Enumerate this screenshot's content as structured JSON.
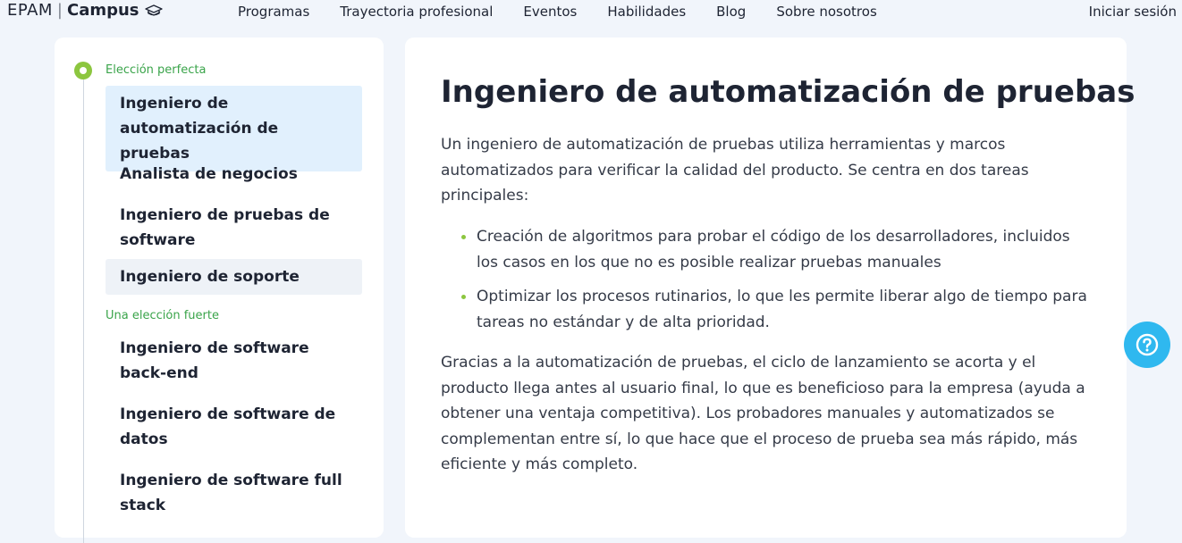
{
  "header": {
    "logo": {
      "brand": "EPAM",
      "separator": "|",
      "product": "Campus",
      "icon": "graduation-cap-icon"
    },
    "nav": [
      "Programas",
      "Trayectoria profesional",
      "Eventos",
      "Habilidades",
      "Blog",
      "Sobre nosotros"
    ],
    "signin_label": "Iniciar sesión"
  },
  "sidebar": {
    "groups": [
      {
        "label": "Elección perfecta",
        "items": [
          {
            "label": "Ingeniero de automatización de pruebas",
            "state": "active"
          },
          {
            "label": "Analista de negocios",
            "state": "normal"
          },
          {
            "label": "Ingeniero de pruebas de software",
            "state": "normal"
          },
          {
            "label": "Ingeniero de soporte",
            "state": "hover"
          }
        ]
      },
      {
        "label": "Una elección fuerte",
        "items": [
          {
            "label": "Ingeniero de software back-end",
            "state": "normal"
          },
          {
            "label": "Ingeniero de software de datos",
            "state": "normal"
          },
          {
            "label": "Ingeniero de software full stack",
            "state": "normal"
          }
        ]
      }
    ]
  },
  "content": {
    "title": "Ingeniero de automatización de pruebas",
    "intro": "Un ingeniero de automatización de pruebas utiliza herramientas y marcos automatizados para verificar la calidad del producto. Se centra en dos tareas principales:",
    "bullets": [
      "Creación de algoritmos para probar el código de los desarrolladores, incluidos los casos en los que no es posible realizar pruebas manuales",
      "Optimizar los procesos rutinarios, lo que les permite liberar algo de tiempo para tareas no estándar y de alta prioridad."
    ],
    "closing": "Gracias a la automatización de pruebas, el ciclo de lanzamiento se acorta y el producto llega antes al usuario final, lo que es beneficioso para la empresa (ayuda a obtener una ventaja competitiva). Los probadores manuales y automatizados se complementan entre sí, lo que hace que el proceso de prueba sea más rápido, más eficiente y más completo."
  },
  "help_button": {
    "icon": "question-mark-icon"
  },
  "colors": {
    "background": "#f1f5fb",
    "accent_green": "#8cc63f",
    "group_label_green": "#3aa44a",
    "active_item_bg": "#e1f0fd",
    "help_button_bg": "#2fb8ef",
    "text_dark": "#1e2433"
  }
}
